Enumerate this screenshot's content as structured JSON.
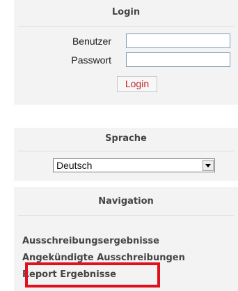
{
  "login": {
    "title": "Login",
    "user_label": "Benutzer",
    "user_value": "",
    "password_label": "Passwort",
    "password_value": "",
    "button_label": "Login"
  },
  "language": {
    "title": "Sprache",
    "selected": "Deutsch"
  },
  "navigation": {
    "title": "Navigation",
    "items": [
      {
        "label": "Ausschreibungsergebnisse"
      },
      {
        "label": "Angekündigte Ausschreibungen"
      },
      {
        "label": "Report Ergebnisse",
        "highlighted": true
      }
    ]
  },
  "colors": {
    "panel_bg": "#f3f3f3",
    "button_text": "#c0272d",
    "highlight_border": "#e0101c"
  }
}
